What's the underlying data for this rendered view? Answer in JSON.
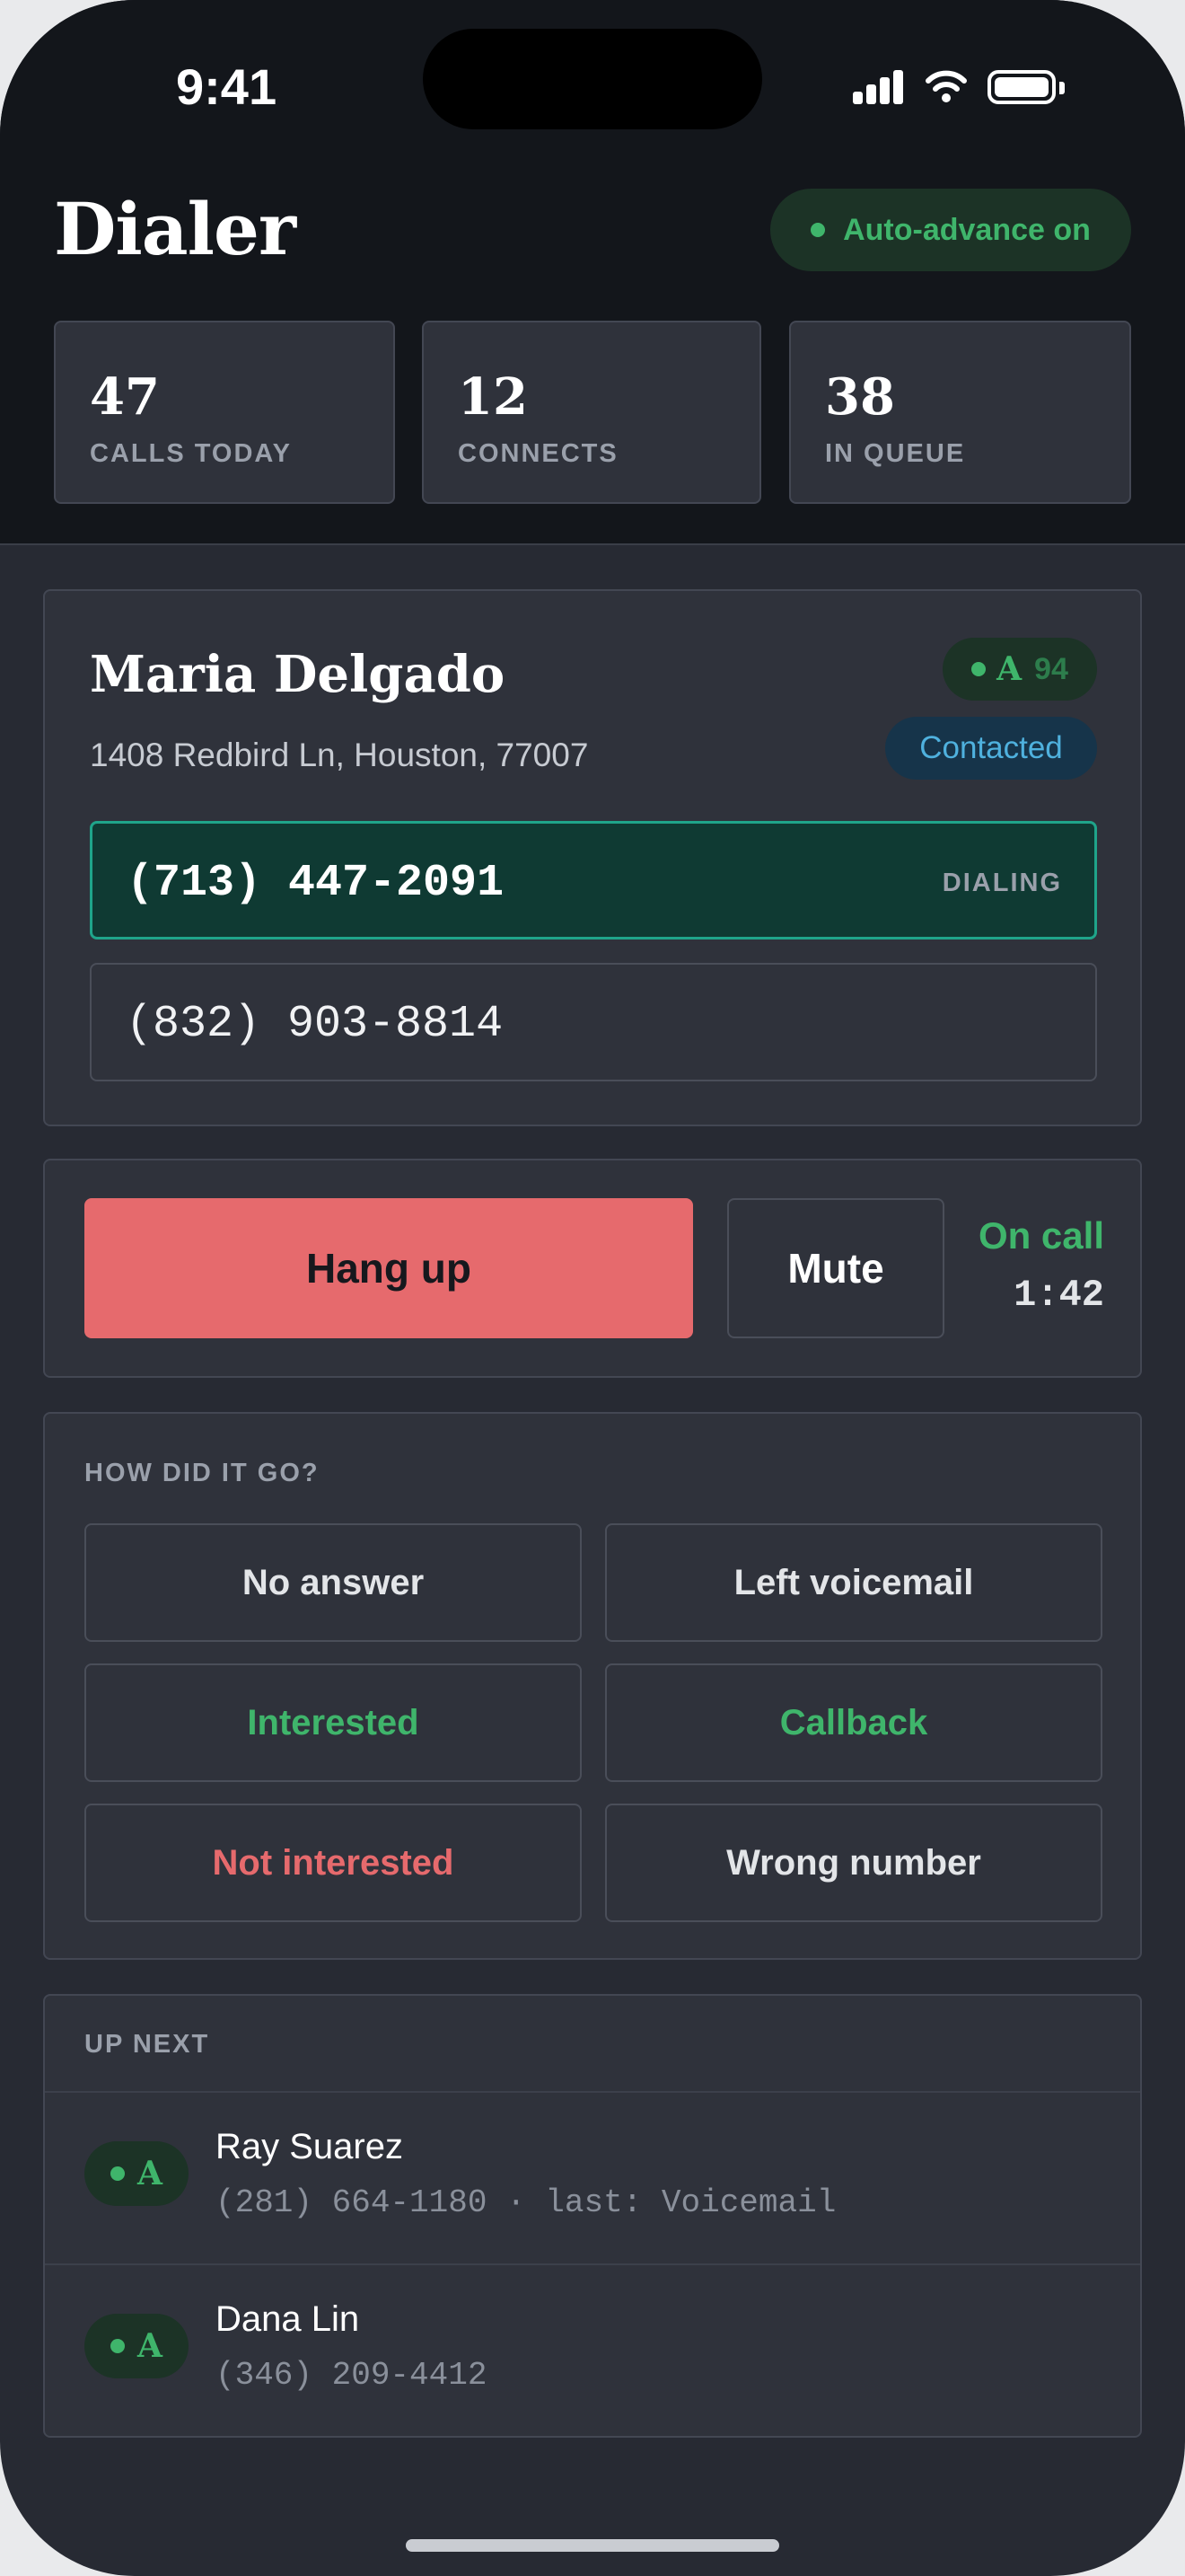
{
  "status_bar": {
    "time": "9:41"
  },
  "header": {
    "title": "Dialer",
    "auto_advance": "Auto-advance on"
  },
  "stats": [
    {
      "value": "47",
      "label": "CALLS TODAY"
    },
    {
      "value": "12",
      "label": "CONNECTS"
    },
    {
      "value": "38",
      "label": "IN QUEUE"
    }
  ],
  "lead": {
    "name": "Maria Delgado",
    "address": "1408 Redbird Ln, Houston, 77007",
    "grade": "A",
    "score": "94",
    "status": "Contacted",
    "phones": [
      {
        "number": "(713) 447-2091",
        "state": "DIALING"
      },
      {
        "number": "(832) 903-8814",
        "state": ""
      }
    ]
  },
  "call_controls": {
    "hangup": "Hang up",
    "mute": "Mute",
    "status": "On call",
    "timer": "1:42"
  },
  "outcome": {
    "label": "HOW DID IT GO?",
    "options": [
      "No answer",
      "Left voicemail",
      "Interested",
      "Callback",
      "Not interested",
      "Wrong number"
    ]
  },
  "queue": {
    "label": "UP NEXT",
    "items": [
      {
        "grade": "A",
        "name": "Ray Suarez",
        "sub": "(281) 664-1180 · last: Voicemail"
      },
      {
        "grade": "A",
        "name": "Dana Lin",
        "sub": "(346) 209-4412"
      }
    ]
  },
  "colors": {
    "accent_green": "#3fb56b",
    "danger_red": "#e66a6d",
    "dialing_teal": "#1fa48a",
    "contacted_blue": "#4fb1de"
  }
}
